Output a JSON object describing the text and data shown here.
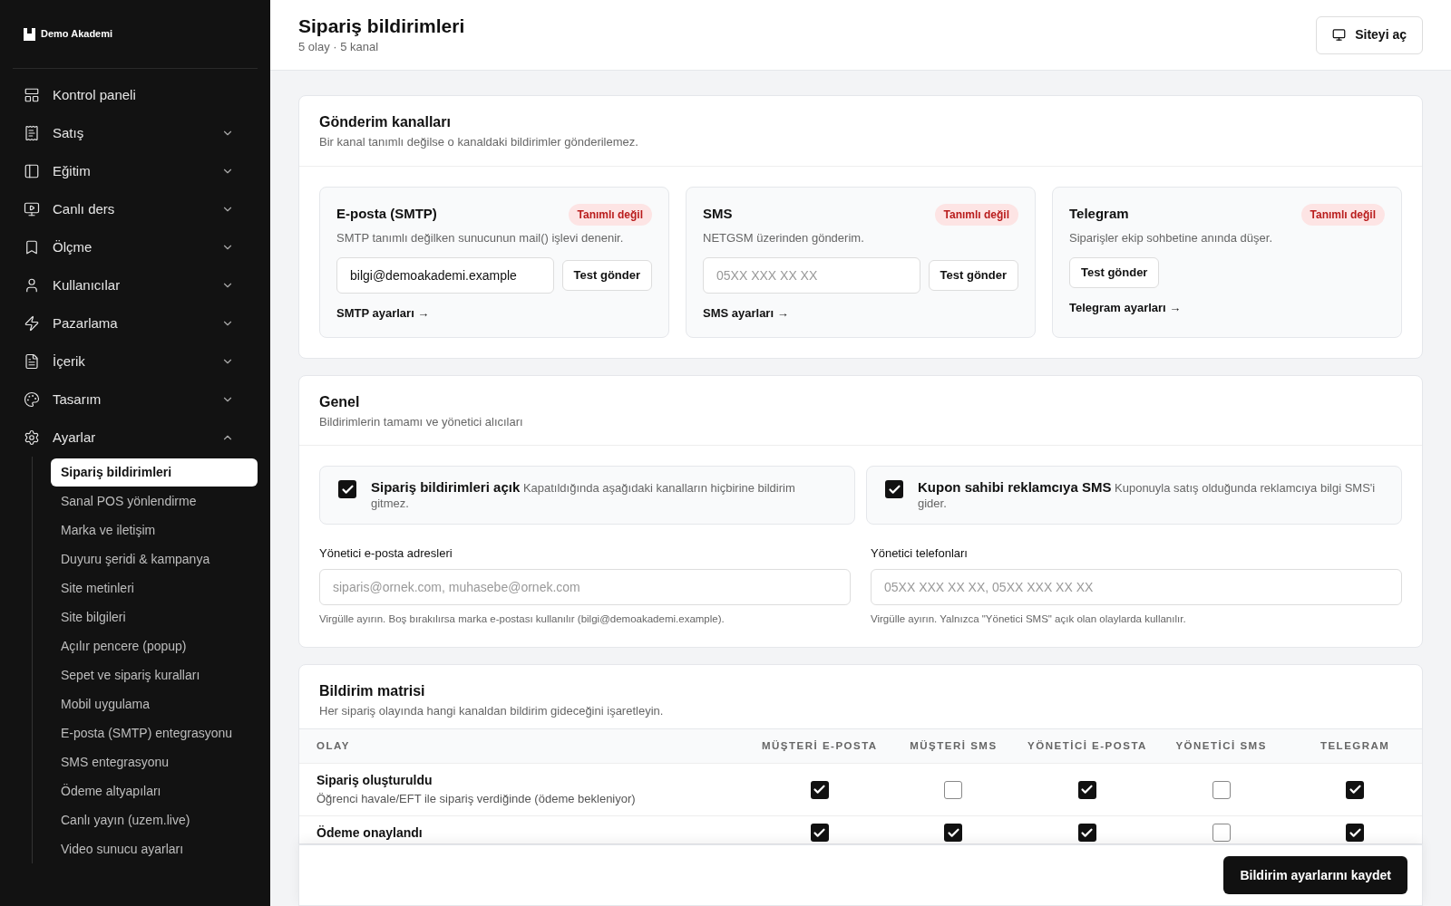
{
  "sidebar": {
    "brand": "Demo Akademi",
    "items": [
      {
        "label": "Kontrol paneli",
        "kind": "link"
      },
      {
        "label": "Satış",
        "kind": "group",
        "expanded": false
      },
      {
        "label": "Eğitim",
        "kind": "group",
        "expanded": false
      },
      {
        "label": "Canlı ders",
        "kind": "group",
        "expanded": false
      },
      {
        "label": "Ölçme",
        "kind": "group",
        "expanded": false
      },
      {
        "label": "Kullanıcılar",
        "kind": "group",
        "expanded": false
      },
      {
        "label": "Pazarlama",
        "kind": "group",
        "expanded": false
      },
      {
        "label": "İçerik",
        "kind": "group",
        "expanded": false
      },
      {
        "label": "Tasarım",
        "kind": "group",
        "expanded": false
      },
      {
        "label": "Ayarlar",
        "kind": "group",
        "expanded": true,
        "children": [
          {
            "label": "Sipariş bildirimleri",
            "selected": true
          },
          {
            "label": "Sanal POS yönlendirme",
            "selected": false
          },
          {
            "label": "Marka ve iletişim",
            "selected": false
          },
          {
            "label": "Duyuru şeridi & kampanya",
            "selected": false
          },
          {
            "label": "Site metinleri",
            "selected": false
          },
          {
            "label": "Site bilgileri",
            "selected": false
          },
          {
            "label": "Açılır pencere (popup)",
            "selected": false
          },
          {
            "label": "Sepet ve sipariş kuralları",
            "selected": false
          },
          {
            "label": "Mobil uygulama",
            "selected": false
          },
          {
            "label": "E-posta (SMTP) entegrasyonu",
            "selected": false
          },
          {
            "label": "SMS entegrasyonu",
            "selected": false
          },
          {
            "label": "Ödeme altyapıları",
            "selected": false
          },
          {
            "label": "Canlı yayın (uzem.live)",
            "selected": false
          },
          {
            "label": "Video sunucu ayarları",
            "selected": false
          }
        ]
      }
    ]
  },
  "header": {
    "title": "Sipariş bildirimleri",
    "subtitle": "5 olay · 5 kanal",
    "open_site_button": "Siteyi aç"
  },
  "channels_section": {
    "title": "Gönderim kanalları",
    "description": "Bir kanal tanımlı değilse o kanaldaki bildirimler gönderilemez.",
    "channels": [
      {
        "name": "E-posta (SMTP)",
        "status": "Tanımlı değil",
        "description": "SMTP tanımlı değilken sunucunun mail() işlevi denenir.",
        "input": {
          "value": "bilgi@demoakademi.example"
        },
        "test_button": "Test gönder",
        "settings_link": "SMTP ayarları →"
      },
      {
        "name": "SMS",
        "status": "Tanımlı değil",
        "description": "NETGSM üzerinden gönderim.",
        "input": {
          "placeholder": "05XX XXX XX XX"
        },
        "test_button": "Test gönder",
        "settings_link": "SMS ayarları →"
      },
      {
        "name": "Telegram",
        "status": "Tanımlı değil",
        "description": "Siparişler ekip sohbetine anında düşer.",
        "test_button": "Test gönder",
        "settings_link": "Telegram ayarları →"
      }
    ]
  },
  "general_section": {
    "title": "Genel",
    "description": "Bildirimlerin tamamı ve yönetici alıcıları",
    "toggles": [
      {
        "label": "Sipariş bildirimleri açık",
        "description": "Kapatıldığında aşağıdaki kanalların hiçbirine bildirim gitmez.",
        "checked": true
      },
      {
        "label": "Kupon sahibi reklamcıya SMS",
        "description": "Kuponuyla satış olduğunda reklamcıya bilgi SMS'i gider.",
        "checked": true
      }
    ],
    "fields": [
      {
        "label": "Yönetici e-posta adresleri",
        "placeholder": "siparis@ornek.com, muhasebe@ornek.com",
        "hint": "Virgülle ayırın. Boş bırakılırsa marka e-postası kullanılır (bilgi@demoakademi.example)."
      },
      {
        "label": "Yönetici telefonları",
        "placeholder": "05XX XXX XX XX, 05XX XXX XX XX",
        "hint": "Virgülle ayırın. Yalnızca \"Yönetici SMS\" açık olan olaylarda kullanılır."
      }
    ]
  },
  "matrix_section": {
    "title": "Bildirim matrisi",
    "description": "Her sipariş olayında hangi kanaldan bildirim gideceğini işaretleyin.",
    "columns": [
      "OLAY",
      "MÜŞTERİ E-POSTA",
      "MÜŞTERİ SMS",
      "YÖNETİCİ E-POSTA",
      "YÖNETİCİ SMS",
      "TELEGRAM"
    ],
    "rows": [
      {
        "event": "Sipariş oluşturuldu",
        "description": "Öğrenci havale/EFT ile sipariş verdiğinde (ödeme bekleniyor)",
        "checks": [
          true,
          false,
          true,
          false,
          true
        ]
      },
      {
        "event": "Ödeme onaylandı",
        "checks": [
          true,
          true,
          true,
          false,
          true
        ]
      }
    ]
  },
  "save_button": "Bildirim ayarlarını kaydet"
}
